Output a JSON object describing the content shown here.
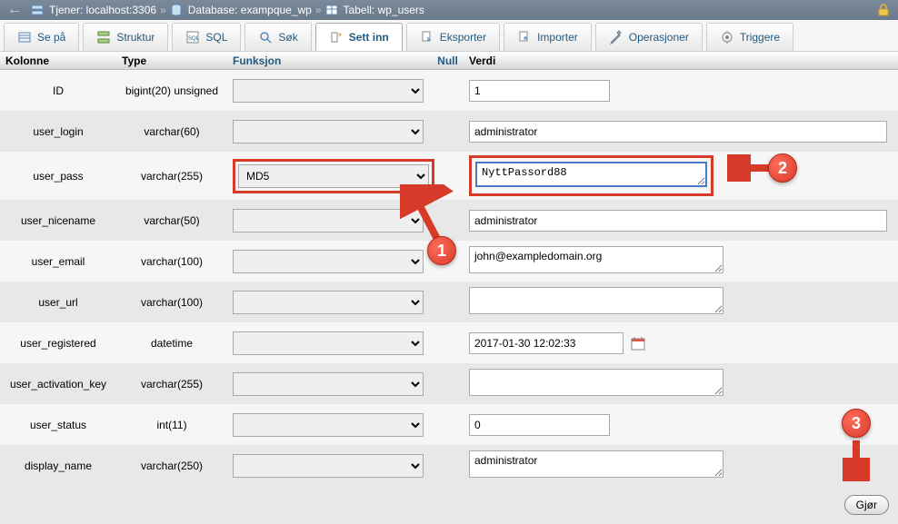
{
  "breadcrumb": {
    "server_label": "Tjener: localhost:3306",
    "db_label": "Database: exampque_wp",
    "table_label": "Tabell: wp_users"
  },
  "tabs": {
    "browse": "Se på",
    "structure": "Struktur",
    "sql": "SQL",
    "search": "Søk",
    "insert": "Sett inn",
    "export": "Eksporter",
    "import": "Importer",
    "operations": "Operasjoner",
    "triggers": "Triggere"
  },
  "headers": {
    "column": "Kolonne",
    "type": "Type",
    "function": "Funksjon",
    "null": "Null",
    "value": "Verdi"
  },
  "rows": [
    {
      "name": "ID",
      "type": "bigint(20) unsigned",
      "func": "",
      "value": "1",
      "input": "text",
      "width": "w-small"
    },
    {
      "name": "user_login",
      "type": "varchar(60)",
      "func": "",
      "value": "administrator",
      "input": "text",
      "width": "w-wide"
    },
    {
      "name": "user_pass",
      "type": "varchar(255)",
      "func": "MD5",
      "value": "NyttPassord88",
      "input": "textarea_hl",
      "width": ""
    },
    {
      "name": "user_nicename",
      "type": "varchar(50)",
      "func": "",
      "value": "administrator",
      "input": "text",
      "width": "w-wide"
    },
    {
      "name": "user_email",
      "type": "varchar(100)",
      "func": "",
      "value": "john@exampledomain.org",
      "input": "textarea",
      "width": "w-med"
    },
    {
      "name": "user_url",
      "type": "varchar(100)",
      "func": "",
      "value": "",
      "input": "textarea",
      "width": "w-med"
    },
    {
      "name": "user_registered",
      "type": "datetime",
      "func": "",
      "value": "2017-01-30 12:02:33",
      "input": "date",
      "width": "w-date"
    },
    {
      "name": "user_activation_key",
      "type": "varchar(255)",
      "func": "",
      "value": "",
      "input": "textarea",
      "width": "w-med"
    },
    {
      "name": "user_status",
      "type": "int(11)",
      "func": "",
      "value": "0",
      "input": "text",
      "width": "w-small"
    },
    {
      "name": "display_name",
      "type": "varchar(250)",
      "func": "",
      "value": "administrator",
      "input": "textarea",
      "width": "w-med"
    }
  ],
  "callouts": {
    "c1": "1",
    "c2": "2",
    "c3": "3"
  },
  "footer": {
    "go": "Gjør"
  }
}
